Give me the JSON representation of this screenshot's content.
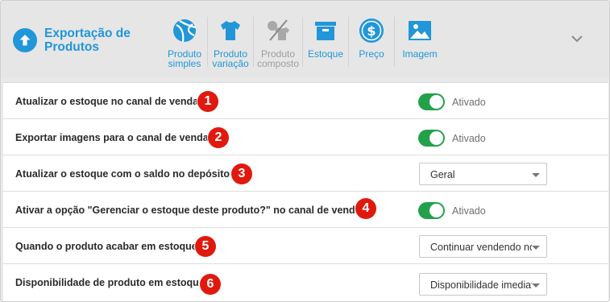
{
  "header": {
    "title": "Exportação de Produtos",
    "title_icon": "arrow-up-circle-icon",
    "tabs": [
      {
        "label": "Produto simples",
        "icon": "ball-icon",
        "disabled": false
      },
      {
        "label": "Produto variação",
        "icon": "tshirt-icon",
        "disabled": false
      },
      {
        "label": "Produto composto",
        "icon": "composite-product-icon",
        "disabled": true
      },
      {
        "label": "Estoque",
        "icon": "box-icon",
        "disabled": false
      },
      {
        "label": "Preço",
        "icon": "dollar-coin-icon",
        "disabled": false
      },
      {
        "label": "Imagem",
        "icon": "image-icon",
        "disabled": false
      }
    ],
    "expand_icon": "chevron-down-icon"
  },
  "settings": [
    {
      "label": "Atualizar o estoque no canal de venda",
      "badge": "1",
      "control": "toggle",
      "value": "Ativado",
      "on": true
    },
    {
      "label": "Exportar imagens para o canal de venda",
      "badge": "2",
      "control": "toggle",
      "value": "Ativado",
      "on": true
    },
    {
      "label": "Atualizar o estoque com o saldo no depósito",
      "badge": "3",
      "control": "select",
      "value": "Geral"
    },
    {
      "label": "Ativar a opção \"Gerenciar o estoque deste produto?\" no canal de venda",
      "badge": "4",
      "control": "toggle",
      "value": "Ativado",
      "on": true
    },
    {
      "label": "Quando o produto acabar em estoque",
      "badge": "5",
      "control": "select",
      "value": "Continuar vendendo no"
    },
    {
      "label": "Disponibilidade de produto em estoque",
      "badge": "6",
      "control": "select",
      "value": "Disponibilidade imediata"
    }
  ],
  "colors": {
    "accent": "#2196d9",
    "toggle_on": "#22a14a",
    "badge": "#e0190f",
    "header_bg": "#e6e6e6"
  }
}
